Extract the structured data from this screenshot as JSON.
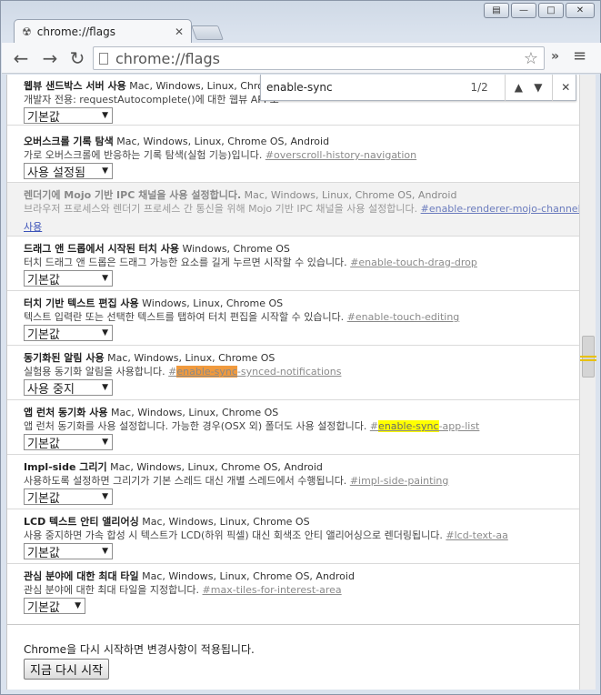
{
  "window": {
    "minimize_glyph": "—",
    "maximize_glyph": "□",
    "close_glyph": "✕",
    "extra_glyph": "▤"
  },
  "tab": {
    "title": "chrome://flags",
    "close": "✕"
  },
  "toolbar": {
    "back": "←",
    "forward": "→",
    "reload": "↻",
    "url": "chrome://flags",
    "star": "☆",
    "extensions": "»",
    "menu": "≡"
  },
  "findbar": {
    "query": "enable-sync",
    "count": "1/2",
    "prev": "⌃",
    "next": "⌄",
    "close": "✕"
  },
  "experiments": [
    {
      "name": "웹뷰 샌드박스 서버 사용",
      "platforms": "Mac, Windows, Linux, Chrome",
      "desc": "개발자 전용: requestAutocomplete()에 대한 웹뷰 API 호",
      "link": "",
      "control": "기본값 ▾",
      "control_label": "기본값"
    },
    {
      "name": "오버스크롤 기록 탐색",
      "platforms": "Mac, Windows, Linux, Chrome OS, Android",
      "desc": "가로 오버스크롤에 반응하는 기록 탐색(실험 기능)입니다.",
      "link": "#overscroll-history-navigation",
      "control_label": "사용 설정됨"
    },
    {
      "name": "렌더기에 Mojo 기반 IPC 채널을 사용 설정합니다.",
      "platforms": "Mac, Windows, Linux, Chrome OS, Android",
      "desc": "브라우저 프로세스와 렌더기 프로세스 간 통신을 위해 Mojo 기반 IPC 채널을 사용 설정합니다.",
      "link": "#enable-renderer-mojo-channel",
      "action": "사용"
    },
    {
      "name": "드래그 앤 드롭에서 시작된 터치 사용",
      "platforms": "Windows, Chrome OS",
      "desc": "터치 드래그 앤 드롭은 드래그 가능한 요소를 길게 누르면 시작할 수 있습니다.",
      "link": "#enable-touch-drag-drop",
      "control_label": "기본값"
    },
    {
      "name": "터치 기반 텍스트 편집 사용",
      "platforms": "Windows, Linux, Chrome OS",
      "desc": "텍스트 입력란 또는 선택한 텍스트를 탭하여 터치 편집을 시작할 수 있습니다.",
      "link": "#enable-touch-editing",
      "control_label": "기본값"
    },
    {
      "name": "동기화된 알림 사용",
      "platforms": "Mac, Windows, Linux, Chrome OS",
      "desc": "실험용 동기화 알림을 사용합니다.",
      "link_pre": "#",
      "link_hl": "enable-sync",
      "link_post": "-synced-notifications",
      "control_label": "사용 중지"
    },
    {
      "name": "앱 런처 동기화 사용",
      "platforms": "Mac, Windows, Linux, Chrome OS",
      "desc": "앱 런처 동기화를 사용 설정합니다. 가능한 경우(OSX 외) 폴더도 사용 설정합니다.",
      "link_pre": "#",
      "link_hl": "enable-sync",
      "link_post": "-app-list",
      "control_label": "기본값"
    },
    {
      "name": "Impl-side 그리기",
      "platforms": "Mac, Windows, Linux, Chrome OS, Android",
      "desc": "사용하도록 설정하면 그리기가 기본 스레드 대신 개별 스레드에서 수행됩니다.",
      "link": "#impl-side-painting",
      "control_label": "기본값"
    },
    {
      "name": "LCD 텍스트 안티 앨리어싱",
      "platforms": "Mac, Windows, Linux, Chrome OS",
      "desc": "사용 중지하면 가속 합성 시 텍스트가 LCD(하위 픽셀) 대신 회색조 안티 앨리어싱으로 렌더링됩니다.",
      "link": "#lcd-text-aa",
      "control_label": "기본값"
    },
    {
      "name": "관심 분야에 대한 최대 타일",
      "platforms": "Mac, Windows, Linux, Chrome OS, Android",
      "desc": "관심 분야에 대한 최대 타일을 지정합니다.",
      "link": "#max-tiles-for-interest-area",
      "control_label": "기본값"
    }
  ],
  "footer": {
    "message": "Chrome을 다시 시작하면 변경사항이 적용됩니다.",
    "restart": "지금 다시 시작"
  },
  "colors": {
    "find_current": "#f09a3e",
    "find_match": "#ffff00"
  }
}
